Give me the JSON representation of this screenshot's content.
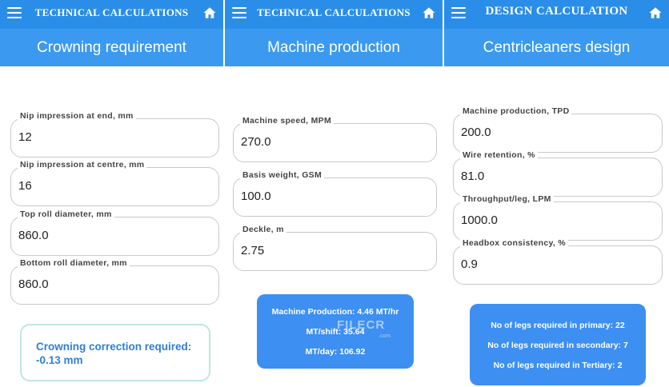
{
  "screens": [
    {
      "app_title": "TECHNICAL CALCULATIONS",
      "page_title": "Crowning requirement",
      "fields": [
        {
          "label": "Nip impression at end, mm",
          "value": "12"
        },
        {
          "label": "Nip impression at centre, mm",
          "value": "16"
        },
        {
          "label": "Top roll diameter, mm",
          "value": "860.0"
        },
        {
          "label": "Bottom roll diameter, mm",
          "value": "860.0"
        }
      ],
      "result": {
        "label": "Crowning correction required:",
        "value": "-0.13 mm"
      }
    },
    {
      "app_title": "TECHNICAL CALCULATIONS",
      "page_title": "Machine production",
      "fields": [
        {
          "label": "Machine speed, MPM",
          "value": "270.0"
        },
        {
          "label": "Basis weight, GSM",
          "value": "100.0"
        },
        {
          "label": "Deckle, m",
          "value": "2.75"
        }
      ],
      "results": [
        "Machine Production:  4.46 MT/hr",
        "MT/shift:  35.64",
        "MT/day:  106.92"
      ],
      "watermark": "FILECR",
      "watermark_sub": ".com"
    },
    {
      "app_title": "DESIGN CALCULATION",
      "page_title": "Centricleaners design",
      "fields": [
        {
          "label": "Machine production, TPD",
          "value": "200.0"
        },
        {
          "label": "Wire retention, %",
          "value": "81.0"
        },
        {
          "label": "Throughput/leg, LPM",
          "value": "1000.0"
        },
        {
          "label": "Headbox consistency, %",
          "value": "0.9"
        }
      ],
      "results": [
        "No of legs required in primary:  22",
        "No of legs required in secondary:  7",
        "No of legs required in Tertiary:  2"
      ]
    }
  ],
  "icons": {
    "menu": "menu-icon",
    "home": "home-icon"
  },
  "colors": {
    "appbar": "#2a8ee8",
    "header": "#3b9af0",
    "result_box": "#3d8ff2",
    "result_text": "#2f7fd6"
  }
}
